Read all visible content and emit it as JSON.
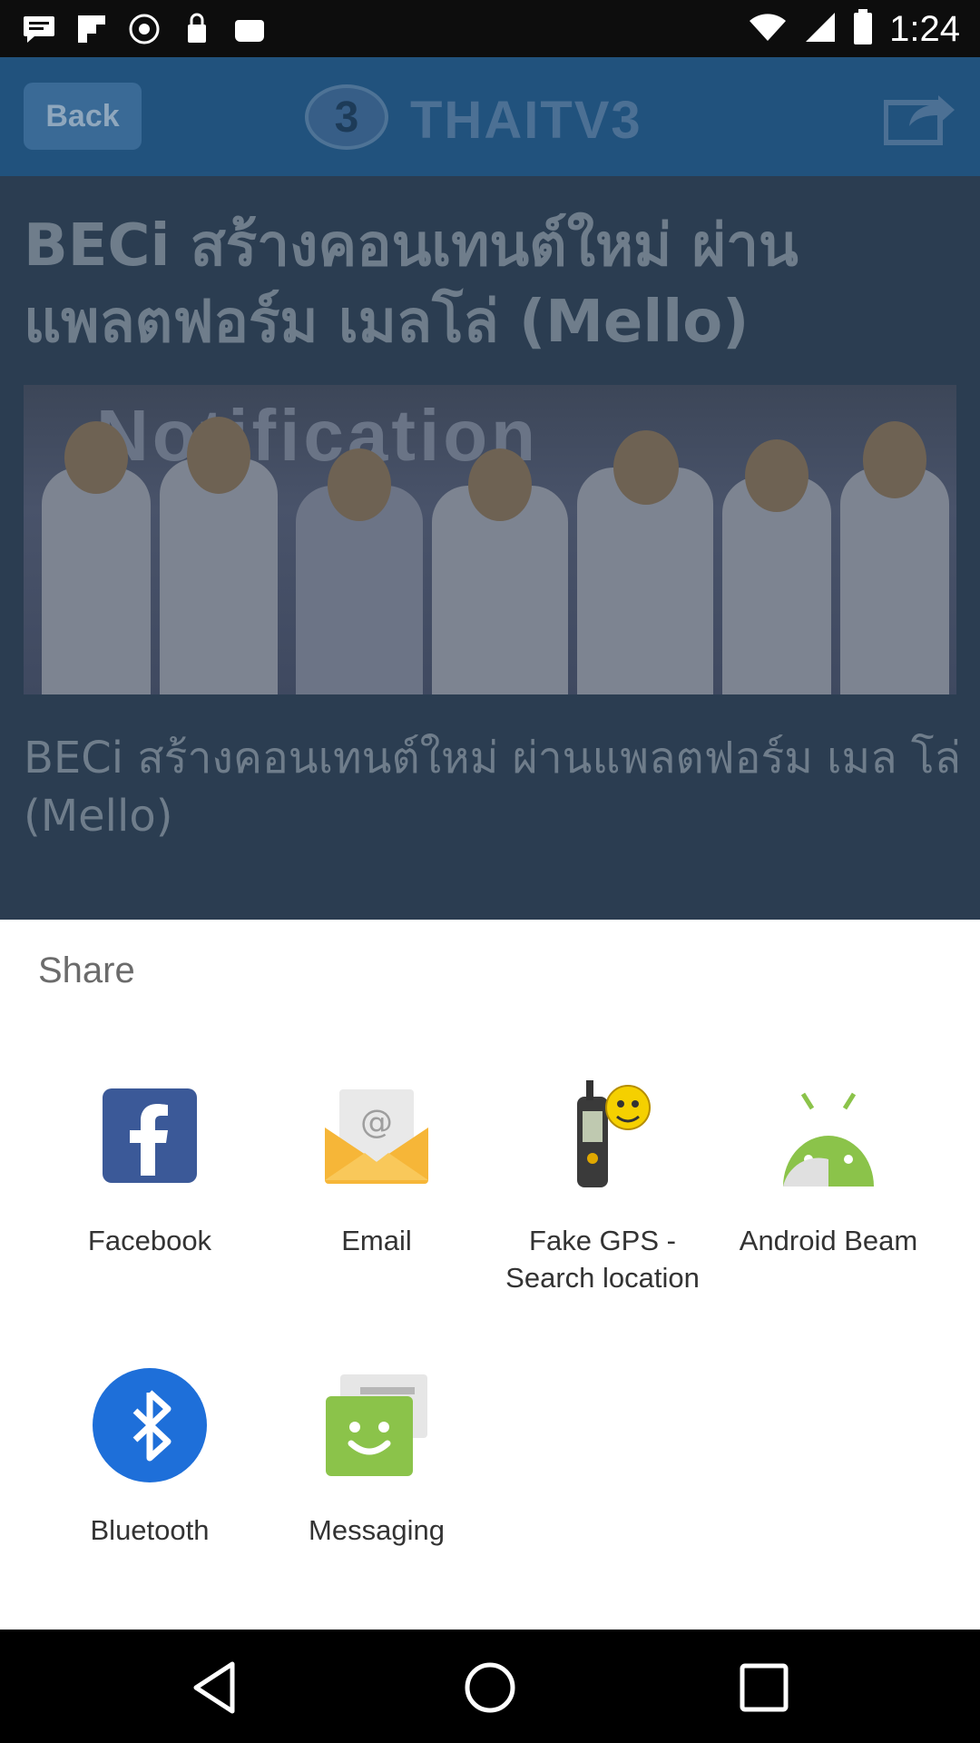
{
  "status_bar": {
    "time": "1:24",
    "left_icons": [
      "message-icon",
      "flipboard-icon",
      "fake-gps-icon",
      "shield-icon",
      "lock-icon",
      "gamepad-icon"
    ],
    "right_icons": [
      "wifi-icon",
      "signal-icon",
      "battery-icon"
    ]
  },
  "app": {
    "toolbar": {
      "back_label": "Back",
      "logo_text": "3",
      "title": "THAITV3"
    },
    "headline": "BECi สร้างคอนเทนต์ใหม่ ผ่าน แพลตฟอร์ม เมลโล่ (Mello)",
    "photo_banner": "Notification",
    "subtitle": "BECi สร้างคอนเทนต์ใหม่ ผ่านแพลตฟอร์ม เมล โล่ (Mello)"
  },
  "share_sheet": {
    "title": "Share",
    "apps": [
      {
        "label": "Facebook",
        "icon": "facebook-icon"
      },
      {
        "label": "Email",
        "icon": "email-icon"
      },
      {
        "label": "Fake GPS -\nSearch location",
        "label_line1": "Fake GPS -",
        "label_line2": "Search location",
        "icon": "fake-gps-icon"
      },
      {
        "label": "Android Beam",
        "icon": "android-beam-icon"
      },
      {
        "label": "Bluetooth",
        "icon": "bluetooth-icon"
      },
      {
        "label": "Messaging",
        "icon": "messaging-icon"
      }
    ]
  },
  "nav_bar": {
    "buttons": [
      "back-icon",
      "home-icon",
      "recents-icon"
    ]
  },
  "colors": {
    "facebook": "#3b5998",
    "android_green": "#8bc34a",
    "bluetooth": "#1e6fd9",
    "messaging_green": "#8bc34a",
    "email_orange": "#f6b638"
  }
}
